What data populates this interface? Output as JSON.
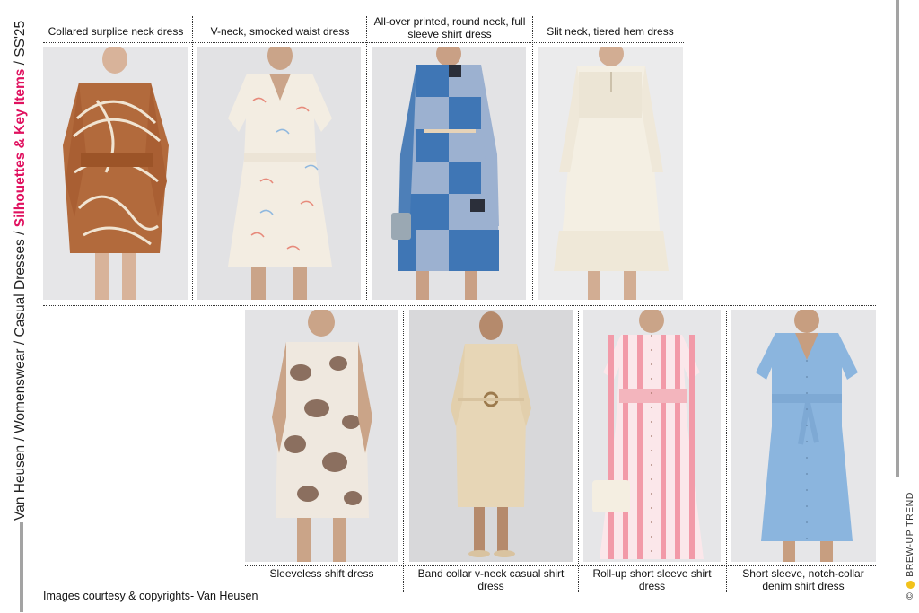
{
  "breadcrumb": {
    "prefix": "Van Heusen / Womenswear / Casual Dresses / ",
    "highlight": "Silhouettes & Key Items",
    "suffix": " / SS'25"
  },
  "brand": {
    "copyright": "©",
    "name": "BREW-UP TREND"
  },
  "top_row": [
    {
      "caption": "Collared surplice neck dress"
    },
    {
      "caption": "V-neck, smocked waist dress"
    },
    {
      "caption": "All-over printed, round neck, full sleeve shirt dress"
    },
    {
      "caption": "Slit neck, tiered hem dress"
    }
  ],
  "bottom_row": [
    {
      "caption": "Sleeveless shift dress"
    },
    {
      "caption": "Band collar v-neck casual shirt dress"
    },
    {
      "caption": "Roll-up short sleeve shirt dress"
    },
    {
      "caption": "Short sleeve, notch-collar denim shirt dress"
    }
  ],
  "footer": "Images courtesy & copyrights- Van Heusen",
  "colors": {
    "accent": "#e0115f",
    "brand_dot": "#f2c21b",
    "bar": "#a3a3a3"
  }
}
